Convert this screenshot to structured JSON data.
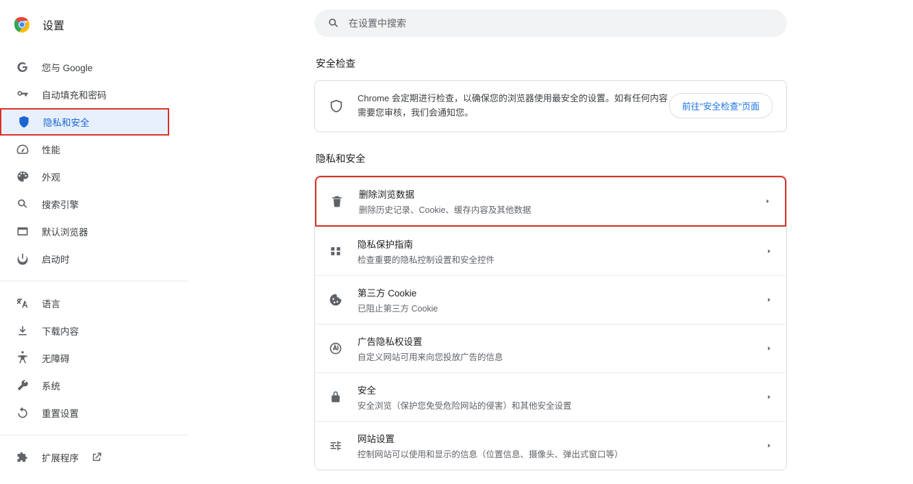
{
  "app_title": "设置",
  "search_placeholder": "在设置中搜索",
  "sidebar": {
    "items": [
      {
        "label": "您与 Google"
      },
      {
        "label": "自动填充和密码"
      },
      {
        "label": "隐私和安全"
      },
      {
        "label": "性能"
      },
      {
        "label": "外观"
      },
      {
        "label": "搜索引擎"
      },
      {
        "label": "默认浏览器"
      },
      {
        "label": "启动时"
      }
    ],
    "items2": [
      {
        "label": "语言"
      },
      {
        "label": "下载内容"
      },
      {
        "label": "无障碍"
      },
      {
        "label": "系统"
      },
      {
        "label": "重置设置"
      }
    ],
    "extensions_label": "扩展程序"
  },
  "section_safety_title": "安全检查",
  "safety_check": {
    "text": "Chrome 会定期进行检查，以确保您的浏览器使用最安全的设置。如有任何内容需要您审核，我们会通知您。",
    "button": "前往\"安全检查\"页面"
  },
  "section_privacy_title": "隐私和安全",
  "privacy_rows": [
    {
      "title": "删除浏览数据",
      "desc": "删除历史记录、Cookie、缓存内容及其他数据"
    },
    {
      "title": "隐私保护指南",
      "desc": "检查重要的隐私控制设置和安全控件"
    },
    {
      "title": "第三方 Cookie",
      "desc": "已阻止第三方 Cookie"
    },
    {
      "title": "广告隐私权设置",
      "desc": "自定义网站可用来向您投放广告的信息"
    },
    {
      "title": "安全",
      "desc": "安全浏览（保护您免受危险网站的侵害）和其他安全设置"
    },
    {
      "title": "网站设置",
      "desc": "控制网站可以使用和显示的信息（位置信息、摄像头、弹出式窗口等）"
    }
  ]
}
